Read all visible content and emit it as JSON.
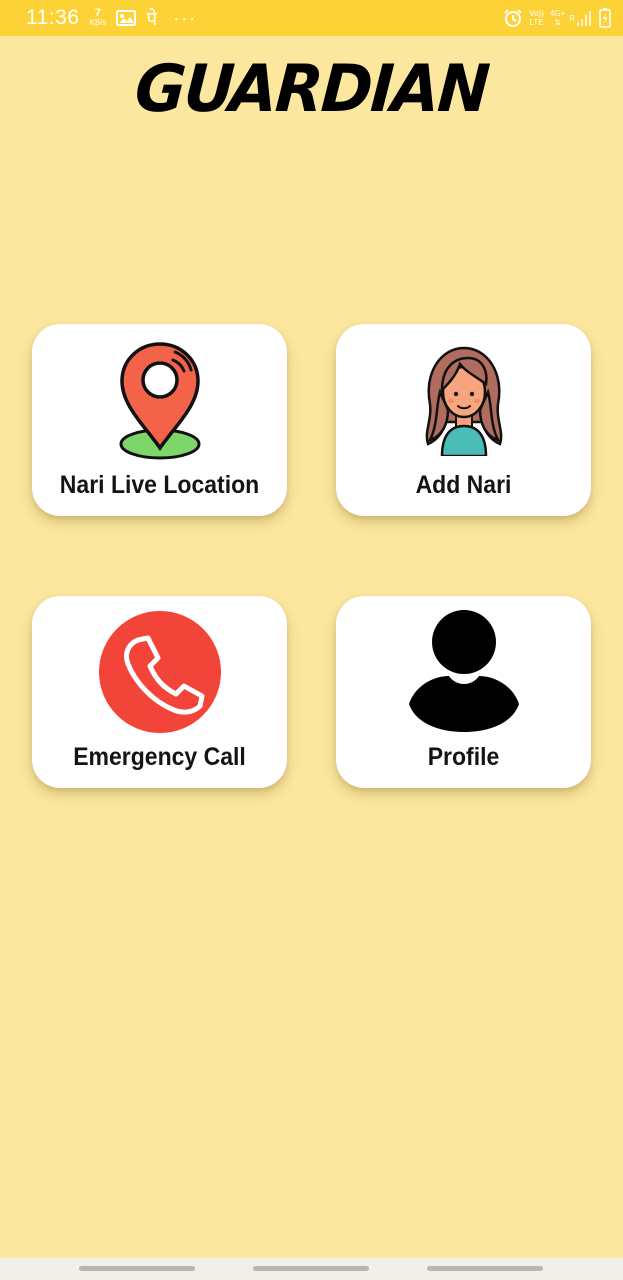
{
  "status_bar": {
    "time": "11:36",
    "speed_value": "7",
    "speed_unit": "KB/s",
    "hindi_char": "पे",
    "more_dots": "···",
    "volte_top": "Vo))",
    "volte_bottom": "LTE",
    "network_type": "4G+",
    "roaming": "R",
    "icons": [
      "gallery-icon",
      "alarm-icon",
      "signal-icon",
      "battery-icon"
    ]
  },
  "app": {
    "title": "GUARDIAN"
  },
  "cards": {
    "live_location": {
      "label": "Nari Live Location",
      "icon": "location-pin-icon"
    },
    "add_nari": {
      "label": "Add Nari",
      "icon": "woman-avatar-icon"
    },
    "emergency_call": {
      "label": "Emergency Call",
      "icon": "phone-icon"
    },
    "profile": {
      "label": "Profile",
      "icon": "person-icon"
    }
  },
  "colors": {
    "background": "#fce79f",
    "status_bar": "#fdd236",
    "card": "#ffffff",
    "pin_red": "#f26349",
    "pin_green": "#7ed66b",
    "call_red": "#f24438",
    "hair_brown": "#b06c5e",
    "skin": "#f7a57e",
    "top_teal": "#4cbcb8"
  }
}
